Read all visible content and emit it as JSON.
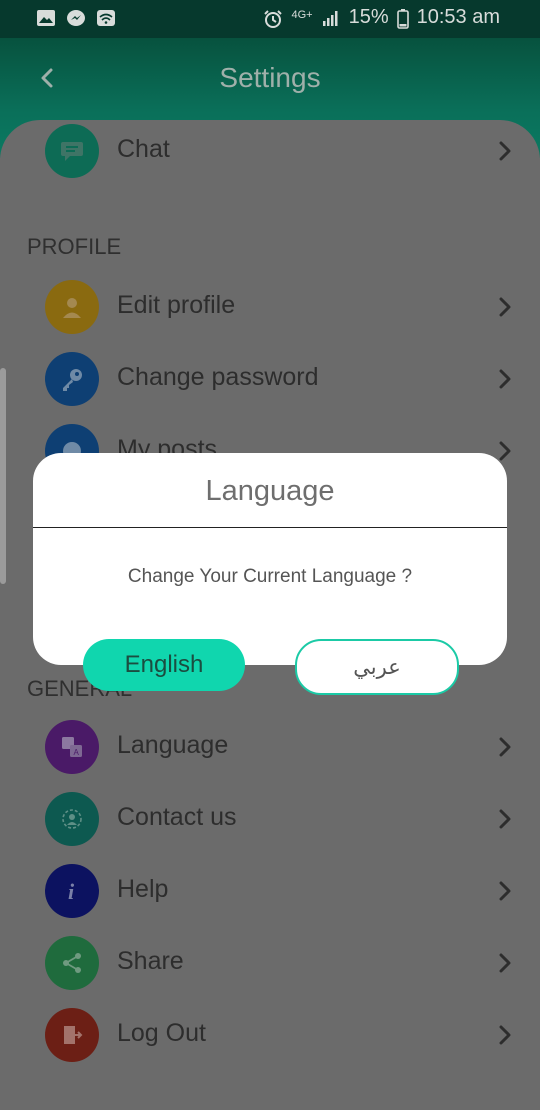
{
  "status_bar": {
    "network": "4G+",
    "battery": "15%",
    "time": "10:53 am"
  },
  "header": {
    "title": "Settings"
  },
  "items": {
    "chat": "Chat",
    "profile_section": "PROFILE",
    "edit_profile": "Edit profile",
    "change_password": "Change password",
    "my_posts": "My posts",
    "general_section": "GENERAL",
    "language": "Language",
    "contact_us": "Contact us",
    "help": "Help",
    "share": "Share",
    "log_out": "Log Out"
  },
  "dialog": {
    "title": "Language",
    "message": "Change Your Current Language ?",
    "english_button": "English",
    "arabic_button": "عربي"
  },
  "colors": {
    "chat": "#0d6b55",
    "edit_profile": "#8a6a10",
    "change_password": "#0e3f73",
    "my_posts": "#0e3f73",
    "language": "#4a1a67",
    "contact_us": "#0d5950",
    "help": "#0c1260",
    "share": "#1f6b3d",
    "log_out": "#6c1f15",
    "accent": "#10d6ae"
  }
}
